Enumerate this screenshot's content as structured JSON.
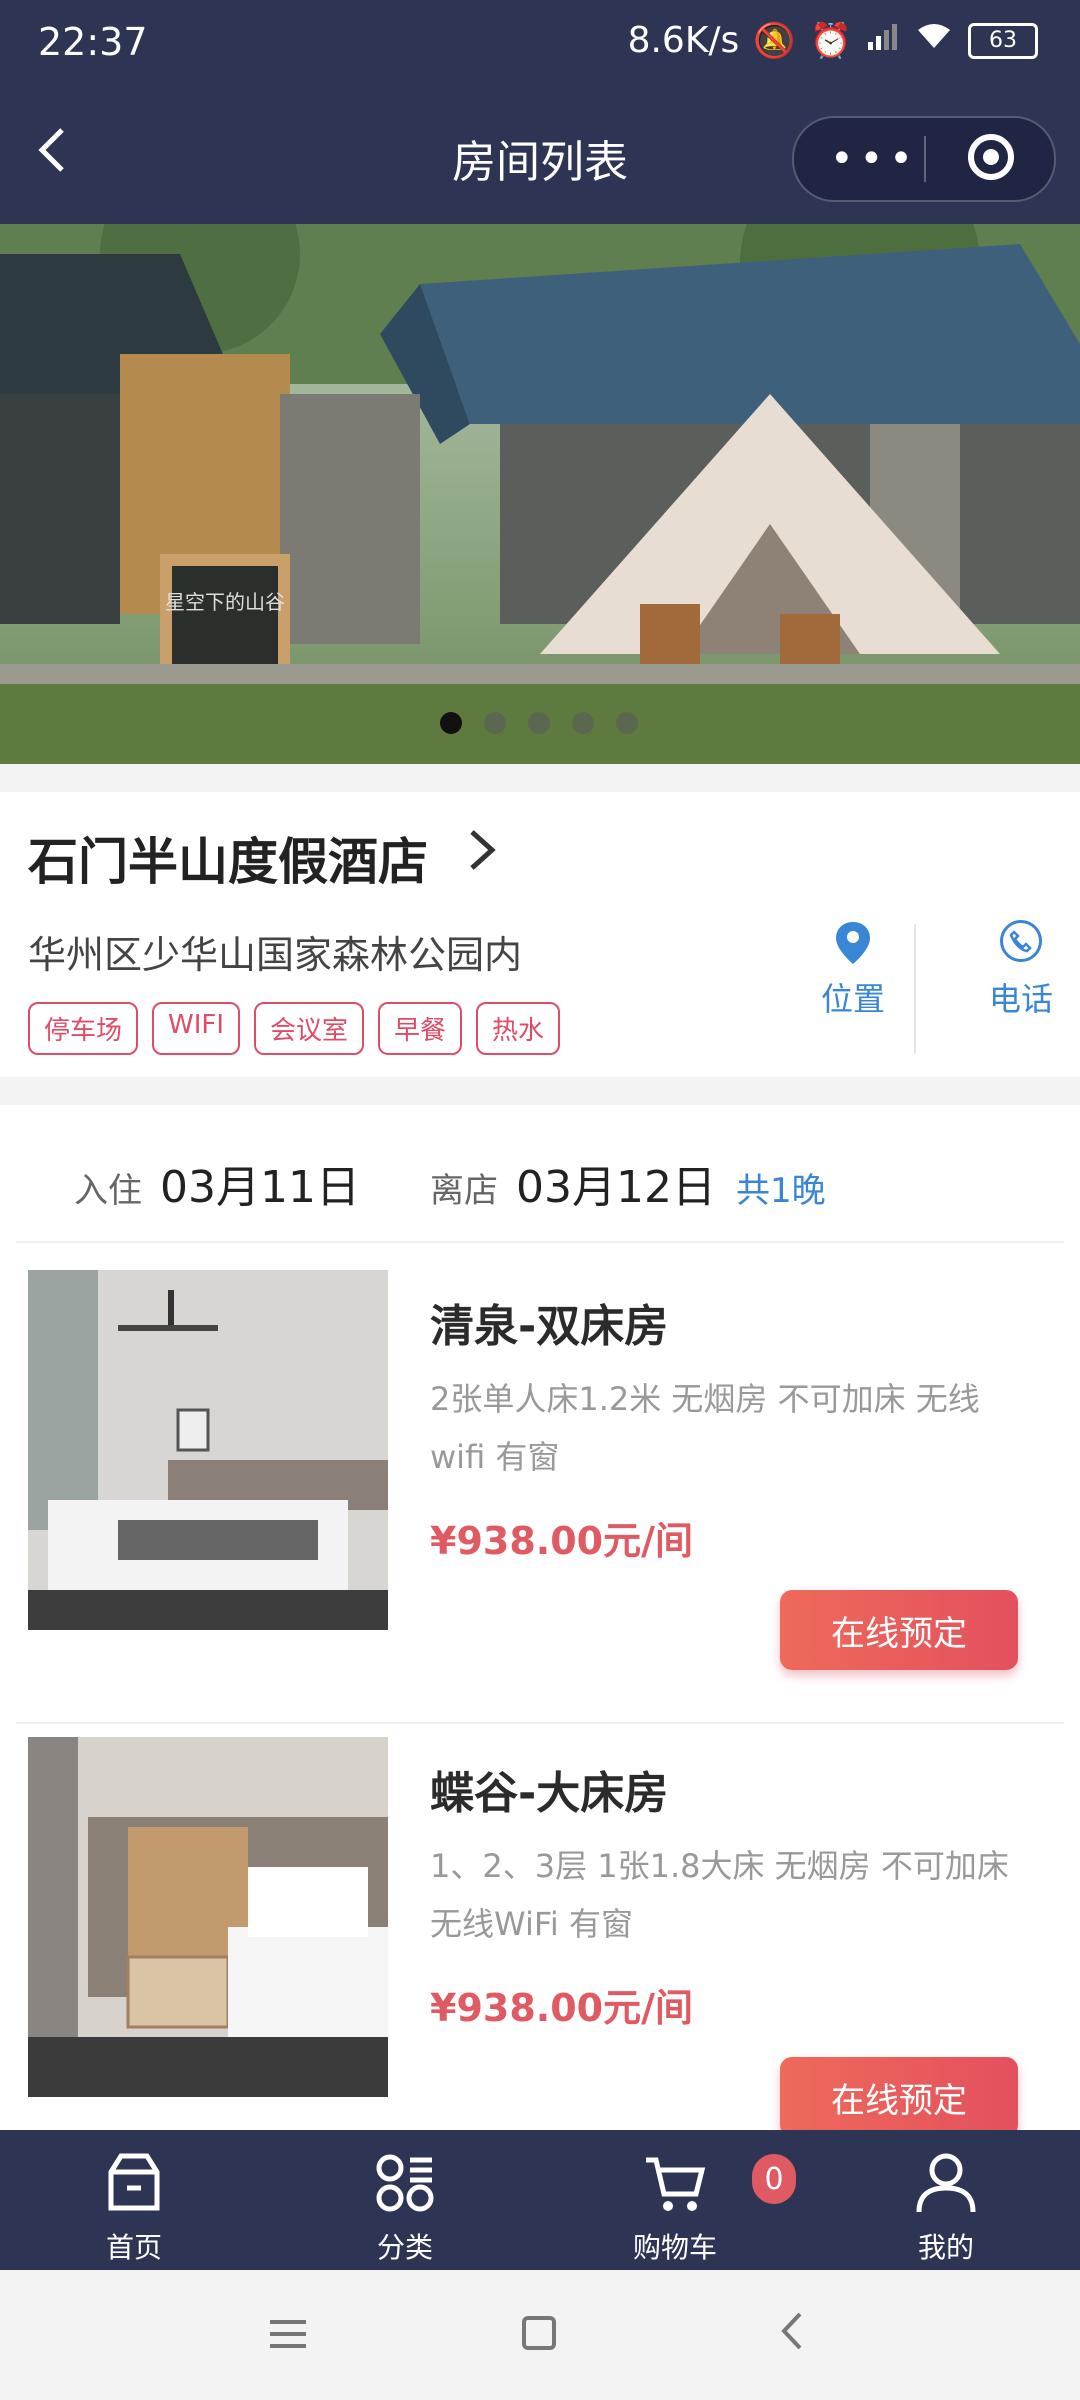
{
  "status_bar": {
    "time": "22:37",
    "network_speed": "8.6K/s",
    "battery": "63",
    "icons": [
      "mute-icon",
      "alarm-icon",
      "signal-icon",
      "wifi-icon",
      "battery-icon"
    ]
  },
  "nav": {
    "title": "房间列表",
    "back_icon": "chevron-left-icon",
    "more_icon": "more-dots-icon",
    "target_icon": "record-target-icon"
  },
  "banner": {
    "sign_text": "星空下的山谷",
    "slide_count": 5,
    "active_slide": 1
  },
  "hotel": {
    "name": "石门半山度假酒店",
    "address": "华州区少华山国家森林公园内",
    "tags": [
      "停车场",
      "WIFI",
      "会议室",
      "早餐",
      "热水"
    ],
    "location_label": "位置",
    "phone_label": "电话"
  },
  "dates": {
    "checkin_label": "入住",
    "checkin_date": "03月11日",
    "checkout_label": "离店",
    "checkout_date": "03月12日",
    "nights": "共1晚"
  },
  "rooms": [
    {
      "name": "清泉-双床房",
      "desc": "2张单人床1.2米  无烟房  不可加床  无线wifi  有窗",
      "price": "¥938.00元/间",
      "button": "在线预定"
    },
    {
      "name": "蝶谷-大床房",
      "desc": "1、2、3层  1张1.8大床  无烟房  不可加床  无线WiFi  有窗",
      "price": "¥938.00元/间",
      "button": "在线预定"
    }
  ],
  "tabs": [
    {
      "label": "首页",
      "icon": "home-icon"
    },
    {
      "label": "分类",
      "icon": "category-icon"
    },
    {
      "label": "购物车",
      "icon": "cart-icon",
      "badge": "0"
    },
    {
      "label": "我的",
      "icon": "user-icon"
    }
  ],
  "colors": {
    "nav_bg": "#2e3554",
    "accent_red": "#e05a64",
    "link_blue": "#3a86d6",
    "tag_pink": "#e04b66"
  }
}
